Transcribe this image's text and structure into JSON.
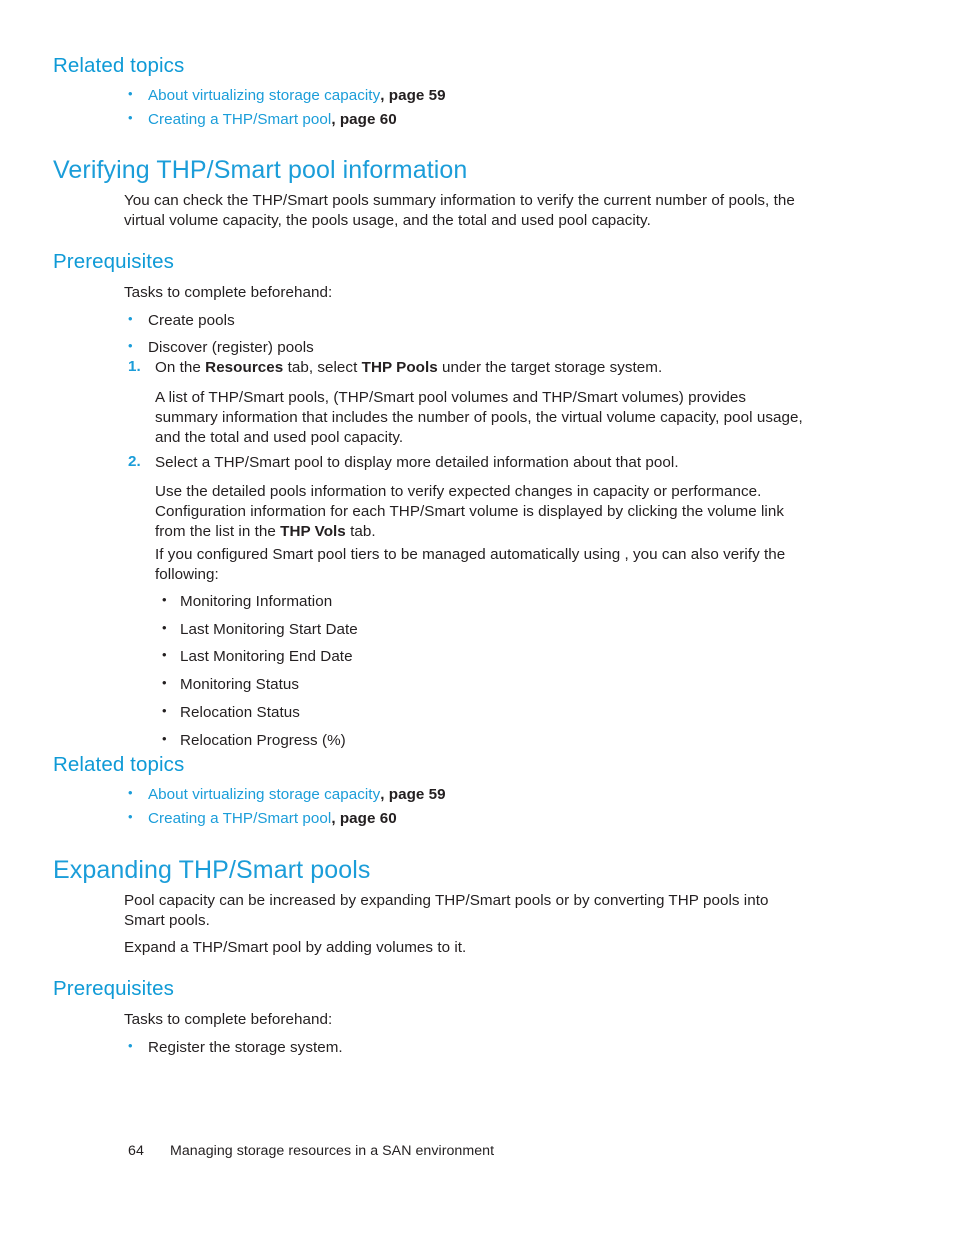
{
  "document": {
    "page_number": "64",
    "footer_title": "Managing storage resources in a SAN environment",
    "colors": {
      "heading_blue": "#1b9dd9",
      "link_blue": "#1b9dd9",
      "body_black": "#231f20"
    }
  },
  "related_topics_top": {
    "heading": "Related topics",
    "items": [
      {
        "link": "About virtualizing storage capacity",
        "page_ref": ", page 59"
      },
      {
        "link": "Creating a THP/Smart pool",
        "page_ref": ", page 60"
      }
    ]
  },
  "section_verifying": {
    "heading": "Verifying THP/Smart pool information",
    "intro": "You can check the THP/Smart pools summary information to verify the current number of pools, the virtual volume capacity, the pools usage, and the total and used pool capacity.",
    "prerequisites": {
      "heading": "Prerequisites",
      "lead": "Tasks to complete beforehand:",
      "items": [
        "Create pools",
        "Discover (register) pools"
      ]
    },
    "steps": [
      {
        "marker": "1.",
        "text_part1": "On the ",
        "bold1": "Resources",
        "text_part2": " tab, select ",
        "bold2": "THP Pools",
        "text_part3": " under the target storage system."
      },
      {
        "marker": "2.",
        "text": "Select a THP/Smart pool to display more detailed information about that pool."
      }
    ],
    "step1_followup": "A list of THP/Smart pools, (THP/Smart pool volumes and THP/Smart volumes) provides summary information that includes the number of pools, the virtual volume capacity, pool usage, and the total and used pool capacity.",
    "step2_followup_part1": "Use the detailed pools information to verify expected changes in capacity or performance. Configuration information for each THP/Smart volume is displayed by clicking the volume link from the list in the ",
    "step2_followup_bold": "THP Vols",
    "step2_followup_part2": " tab.",
    "step2_followup2": "If you configured Smart pool tiers to be managed automatically using , you can also verify the following:",
    "verify_items": [
      "Monitoring Information",
      "Last Monitoring Start Date",
      "Last Monitoring End Date",
      "Monitoring Status",
      "Relocation Status",
      "Relocation Progress (%)"
    ]
  },
  "related_topics_bottom": {
    "heading": "Related topics",
    "items": [
      {
        "link": "About virtualizing storage capacity",
        "page_ref": ", page 59"
      },
      {
        "link": "Creating a THP/Smart pool",
        "page_ref": ", page 60"
      }
    ]
  },
  "section_expanding": {
    "heading": "Expanding THP/Smart pools",
    "para1": "Pool capacity can be increased by expanding THP/Smart pools or by converting THP pools into Smart pools.",
    "para2": "Expand a THP/Smart pool by adding volumes to it.",
    "prerequisites": {
      "heading": "Prerequisites",
      "lead": "Tasks to complete beforehand:",
      "items": [
        "Register the storage system."
      ]
    }
  }
}
